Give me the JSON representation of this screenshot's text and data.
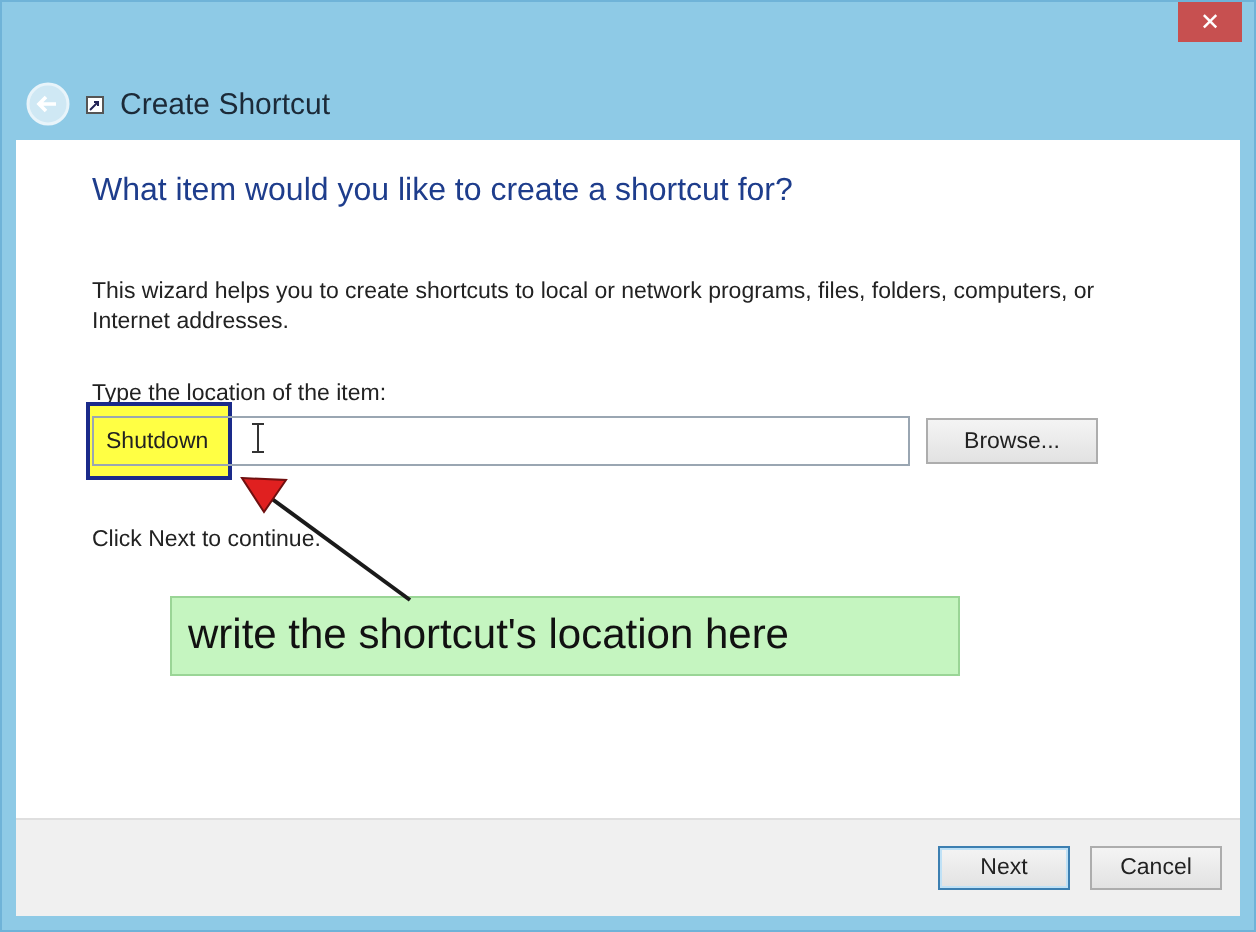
{
  "window": {
    "title": "Create Shortcut",
    "close_label": "✕"
  },
  "heading": "What item would you like to create a shortcut for?",
  "description": "This wizard helps you to create shortcuts to local or network programs, files, folders, computers, or Internet addresses.",
  "location": {
    "label": "Type the location of the item:",
    "value": "Shutdown",
    "browse": "Browse..."
  },
  "hint": "Click Next to continue.",
  "annotation": {
    "callout": "write the shortcut's location here"
  },
  "buttons": [
    {
      "label": "Next",
      "default": true
    },
    {
      "label": "Cancel",
      "default": false
    }
  ]
}
